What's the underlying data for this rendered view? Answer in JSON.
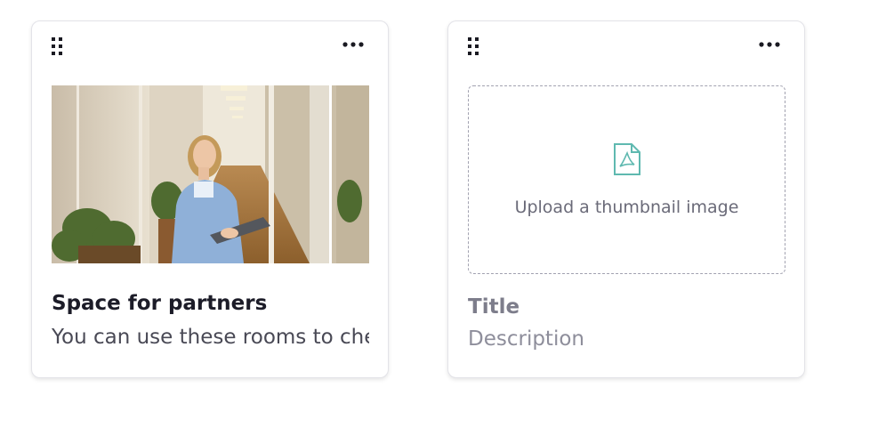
{
  "cards": [
    {
      "drag_icon": "drag-handle-icon",
      "menu_icon": "more-horizontal-icon",
      "image_alt": "Woman holding a tablet walking in an office corridor",
      "title": "Space for partners",
      "description": "You can use these rooms to check your partner meetings"
    },
    {
      "drag_icon": "drag-handle-icon",
      "menu_icon": "more-horizontal-icon",
      "upload_icon": "pdf-file-icon",
      "upload_label": "Upload a thumbnail image",
      "title_placeholder": "Title",
      "description_placeholder": "Description"
    }
  ],
  "colors": {
    "upload_icon": "#5fb9b0",
    "placeholder": "#8e8e9b",
    "title": "#1c1c28"
  }
}
